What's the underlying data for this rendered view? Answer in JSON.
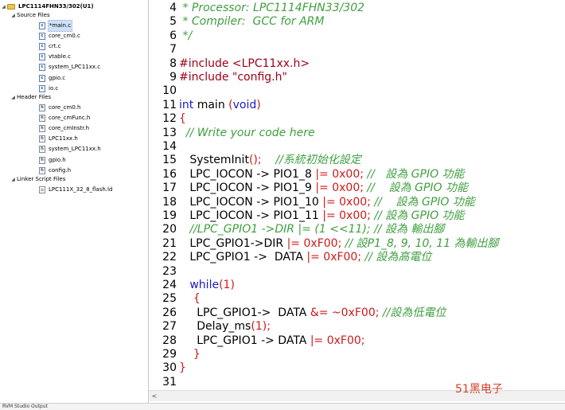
{
  "project_tree": {
    "project": "LPC1114FHN33/302(U1)",
    "source_group": "Source Files",
    "source_files": [
      "*main.c",
      "core_cm0.c",
      "crt.c",
      "vtable.c",
      "system_LPC11xx.c",
      "gpio.c",
      "io.c"
    ],
    "header_group": "Header Files",
    "header_files": [
      "core_cm0.h",
      "core_cmFunc.h",
      "core_cmInstr.h",
      "LPC11xx.h",
      "system_LPC11xx.h",
      "gpio.h",
      "config.h"
    ],
    "linker_group": "Linker Script Files",
    "linker_files": [
      "LPC111X_32_8_flash.ld"
    ]
  },
  "editor": {
    "lines": [
      {
        "n": "4",
        "tokens": [
          {
            "t": " * Processor: LPC1114FHN33/302",
            "c": "cm"
          }
        ]
      },
      {
        "n": "5",
        "tokens": [
          {
            "t": " * Compiler:  GCC for ARM",
            "c": "cm"
          }
        ]
      },
      {
        "n": "6",
        "tokens": [
          {
            "t": " */",
            "c": "cm"
          }
        ]
      },
      {
        "n": "7",
        "tokens": []
      },
      {
        "n": "8",
        "tokens": [
          {
            "t": "#include <LPC11xx.h>",
            "c": "pp"
          }
        ]
      },
      {
        "n": "9",
        "tokens": [
          {
            "t": "#include \"config.h\"",
            "c": "pp"
          }
        ]
      },
      {
        "n": "10",
        "tokens": []
      },
      {
        "n": "11",
        "tokens": [
          {
            "t": "int",
            "c": "kw"
          },
          {
            "t": " main ",
            "c": ""
          },
          {
            "t": "(",
            "c": "pn"
          },
          {
            "t": "void",
            "c": "kw"
          },
          {
            "t": ")",
            "c": "pn"
          }
        ]
      },
      {
        "n": "12",
        "tokens": [
          {
            "t": "{",
            "c": "pn"
          }
        ]
      },
      {
        "n": "13",
        "tokens": [
          {
            "t": "  // Write your code here",
            "c": "cm"
          }
        ]
      },
      {
        "n": "14",
        "tokens": []
      },
      {
        "n": "15",
        "tokens": [
          {
            "t": "   SystemInit",
            "c": ""
          },
          {
            "t": "();",
            "c": "pn"
          },
          {
            "t": "    //系統初始化設定",
            "c": "cm"
          }
        ]
      },
      {
        "n": "16",
        "tokens": [
          {
            "t": "   LPC_IOCON -> PIO1_8 ",
            "c": ""
          },
          {
            "t": "|=",
            "c": "pn"
          },
          {
            "t": " ",
            "c": ""
          },
          {
            "t": "0x00",
            "c": "num"
          },
          {
            "t": ";",
            "c": "pn"
          },
          {
            "t": " //   設為 GPIO 功能",
            "c": "cm"
          }
        ]
      },
      {
        "n": "17",
        "tokens": [
          {
            "t": "   LPC_IOCON -> PIO1_9 ",
            "c": ""
          },
          {
            "t": "|=",
            "c": "pn"
          },
          {
            "t": " ",
            "c": ""
          },
          {
            "t": "0x00",
            "c": "num"
          },
          {
            "t": ";",
            "c": "pn"
          },
          {
            "t": " //    設為 GPIO 功能",
            "c": "cm"
          }
        ]
      },
      {
        "n": "18",
        "tokens": [
          {
            "t": "   LPC_IOCON -> PIO1_10 ",
            "c": ""
          },
          {
            "t": "|=",
            "c": "pn"
          },
          {
            "t": " ",
            "c": ""
          },
          {
            "t": "0x00",
            "c": "num"
          },
          {
            "t": ";",
            "c": "pn"
          },
          {
            "t": " //    設為 GPIO 功能",
            "c": "cm"
          }
        ]
      },
      {
        "n": "19",
        "tokens": [
          {
            "t": "   LPC_IOCON -> PIO1_11 ",
            "c": ""
          },
          {
            "t": "|=",
            "c": "pn"
          },
          {
            "t": " ",
            "c": ""
          },
          {
            "t": "0x00",
            "c": "num"
          },
          {
            "t": ";",
            "c": "pn"
          },
          {
            "t": " // 設為 GPIO 功能",
            "c": "cm"
          }
        ]
      },
      {
        "n": "20",
        "tokens": [
          {
            "t": "   //LPC_GPIO1 ->DIR |= (1 <<11); // 設為 輸出腳",
            "c": "cm"
          }
        ]
      },
      {
        "n": "21",
        "tokens": [
          {
            "t": "   LPC_GPIO1->DIR ",
            "c": ""
          },
          {
            "t": "|=",
            "c": "pn"
          },
          {
            "t": " ",
            "c": ""
          },
          {
            "t": "0xF00",
            "c": "num"
          },
          {
            "t": ";",
            "c": "pn"
          },
          {
            "t": " // 設P1_8, 9, 10, 11 為輸出腳",
            "c": "cm"
          }
        ]
      },
      {
        "n": "22",
        "tokens": [
          {
            "t": "   LPC_GPIO1 ->  DATA ",
            "c": ""
          },
          {
            "t": "|=",
            "c": "pn"
          },
          {
            "t": " ",
            "c": ""
          },
          {
            "t": "0xF00",
            "c": "num"
          },
          {
            "t": ";",
            "c": "pn"
          },
          {
            "t": " // 設為高電位",
            "c": "cm"
          }
        ]
      },
      {
        "n": "23",
        "tokens": []
      },
      {
        "n": "24",
        "tokens": [
          {
            "t": "   ",
            "c": ""
          },
          {
            "t": "while",
            "c": "kw"
          },
          {
            "t": "(",
            "c": "pn"
          },
          {
            "t": "1",
            "c": "num"
          },
          {
            "t": ")",
            "c": "pn"
          }
        ]
      },
      {
        "n": "25",
        "tokens": [
          {
            "t": "    ",
            "c": ""
          },
          {
            "t": "{",
            "c": "pn"
          }
        ]
      },
      {
        "n": "26",
        "tokens": [
          {
            "t": "     LPC_GPIO1->  DATA ",
            "c": ""
          },
          {
            "t": "&=",
            "c": "pn"
          },
          {
            "t": " ~",
            "c": "pn"
          },
          {
            "t": "0xF00",
            "c": "num"
          },
          {
            "t": ";",
            "c": "pn"
          },
          {
            "t": " //設為低電位",
            "c": "cm"
          }
        ]
      },
      {
        "n": "27",
        "tokens": [
          {
            "t": "     Delay_ms",
            "c": ""
          },
          {
            "t": "(",
            "c": "pn"
          },
          {
            "t": "1",
            "c": "num"
          },
          {
            "t": ");",
            "c": "pn"
          }
        ]
      },
      {
        "n": "28",
        "tokens": [
          {
            "t": "     LPC_GPIO1 -> DATA ",
            "c": ""
          },
          {
            "t": "|=",
            "c": "pn"
          },
          {
            "t": " ",
            "c": ""
          },
          {
            "t": "0xF00",
            "c": "num"
          },
          {
            "t": ";",
            "c": "pn"
          }
        ]
      },
      {
        "n": "29",
        "tokens": [
          {
            "t": "    ",
            "c": ""
          },
          {
            "t": "}",
            "c": "pn"
          }
        ]
      },
      {
        "n": "30",
        "tokens": [
          {
            "t": "}",
            "c": "pn"
          }
        ]
      },
      {
        "n": "31",
        "tokens": []
      }
    ]
  },
  "watermark": "51黑电子",
  "bottom_panel": {
    "label": "RVM Studio Output"
  },
  "colors": {
    "comment": "#3f9f3f",
    "preprocessor": "#a0001b",
    "keyword": "#1a1ac8",
    "number": "#cc1a1a",
    "watermark": "#d6402a"
  },
  "icons": {
    "folder": "folder-icon",
    "c_file": "c-file-icon",
    "h_file": "h-file-icon",
    "ld_file": "linker-file-icon",
    "expand": "expand-triangle-icon"
  }
}
